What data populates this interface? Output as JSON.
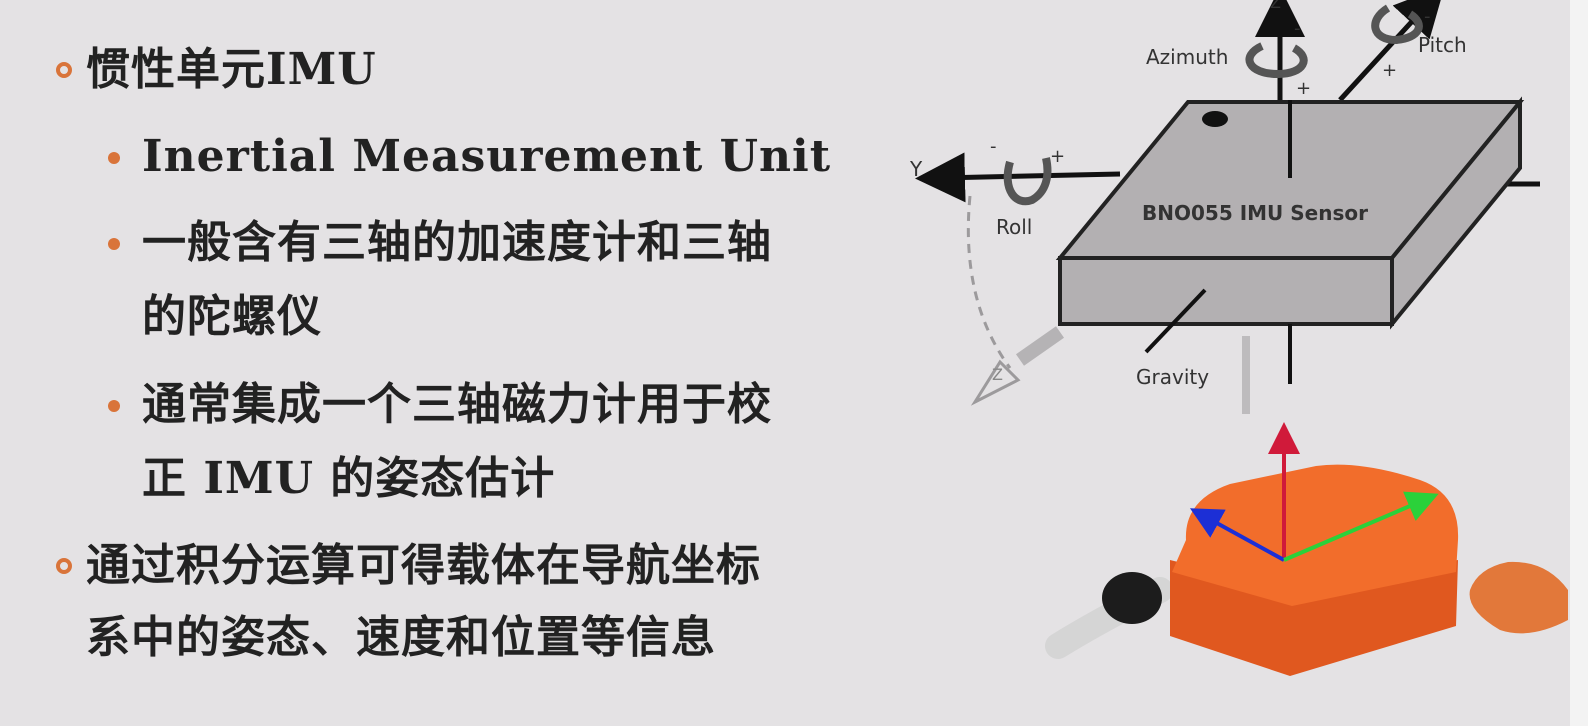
{
  "bullets": {
    "b1": "惯性单元IMU",
    "b1_1": "Inertial Measurement Unit",
    "b1_2_line1": "一般含有三轴的加速度计和三轴",
    "b1_2_line2": "的陀螺仪",
    "b1_3_line1": "通常集成一个三轴磁力计用于校",
    "b1_3_line2": "正 IMU 的姿态估计",
    "b2_line1": "通过积分运算可得载体在导航坐标",
    "b2_line2": "系中的姿态、速度和位置等信息"
  },
  "diagram": {
    "sensor_label": "BNO055 IMU Sensor",
    "azimuth": "Azimuth",
    "pitch": "Pitch",
    "roll": "Roll",
    "gravity": "Gravity",
    "y_axis": "Y",
    "z_axis": "Z",
    "x_axis": "Z",
    "plus": "+",
    "minus": "-"
  },
  "colors": {
    "accent": "#d9743a",
    "background": "#e4e2e4",
    "sensor_face": "#b3b0b2",
    "device_orange": "#f06a2a"
  }
}
